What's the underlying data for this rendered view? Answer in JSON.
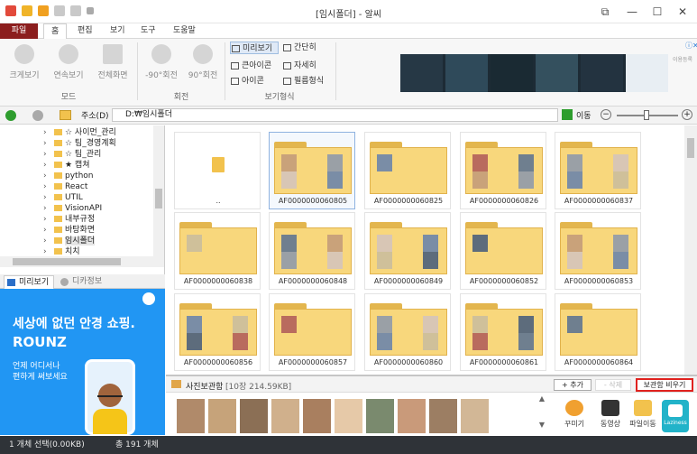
{
  "window": {
    "title": "[임시폴더] - 알씨",
    "controls": [
      "⧉",
      "—",
      "☐",
      "✕"
    ]
  },
  "menu": {
    "file": "파일",
    "tabs": [
      "홈",
      "편집",
      "보기",
      "도구",
      "도움말"
    ]
  },
  "ribbon": {
    "buttons": [
      "크게보기",
      "연속보기",
      "전체화면",
      "-90°회전",
      "90°회전"
    ],
    "groups": [
      "모드",
      "회전",
      "보기형식"
    ],
    "view_options": [
      "미리보기",
      "간단히",
      "큰아이콘",
      "자세히",
      "아이콘",
      "필름형식"
    ],
    "ad_corner": "이용등록"
  },
  "address": {
    "label": "주소(D)",
    "path": "D:₩임시폴더",
    "go": "이동"
  },
  "tree": {
    "items": [
      {
        "label": "☆ 사이먼_관리"
      },
      {
        "label": "☆ 팀_경영계획"
      },
      {
        "label": "☆ 팀_관리"
      },
      {
        "label": "★ 캡쳐"
      },
      {
        "label": "python"
      },
      {
        "label": "React"
      },
      {
        "label": "UTIL"
      },
      {
        "label": "VisionAPI"
      },
      {
        "label": "내부규정"
      },
      {
        "label": "바탕화면"
      },
      {
        "label": "임시폴더"
      },
      {
        "label": "치치"
      }
    ]
  },
  "preview_tabs": [
    "미리보기",
    "디카정보"
  ],
  "ad": {
    "headline": "세상에 없던 안경 쇼핑.",
    "brand": "ROUNZ",
    "sub1": "언제 어디서나",
    "sub2": "편하게 써보세요"
  },
  "files": {
    "parent": "..",
    "items": [
      "AF0000000060805",
      "AF0000000060825",
      "AF0000000060826",
      "AF0000000060837",
      "AF0000000060838",
      "AF0000000060848",
      "AF0000000060849",
      "AF0000000060852",
      "AF0000000060853",
      "AF0000000060856",
      "AF0000000060857",
      "AF0000000060860",
      "AF0000000060861",
      "AF0000000060864"
    ]
  },
  "photo_box": {
    "title": "사진보관함",
    "info": "[10장 214.59KB]",
    "add": "+ 추가",
    "delete": "- 삭제",
    "empty": "보관함 비우기",
    "tools": [
      "꾸미기",
      "동영상",
      "파일이동"
    ],
    "badge": "Laziness"
  },
  "status": {
    "selection": "1 개체 선택(0.00KB)",
    "total": "총 191 개체"
  },
  "colors": {
    "file_tab": "#8c1e1e",
    "folder": "#f8d77c",
    "status_bg": "#2f3338",
    "ad_bg": "#2196f3",
    "highlight": "#e0221f"
  }
}
